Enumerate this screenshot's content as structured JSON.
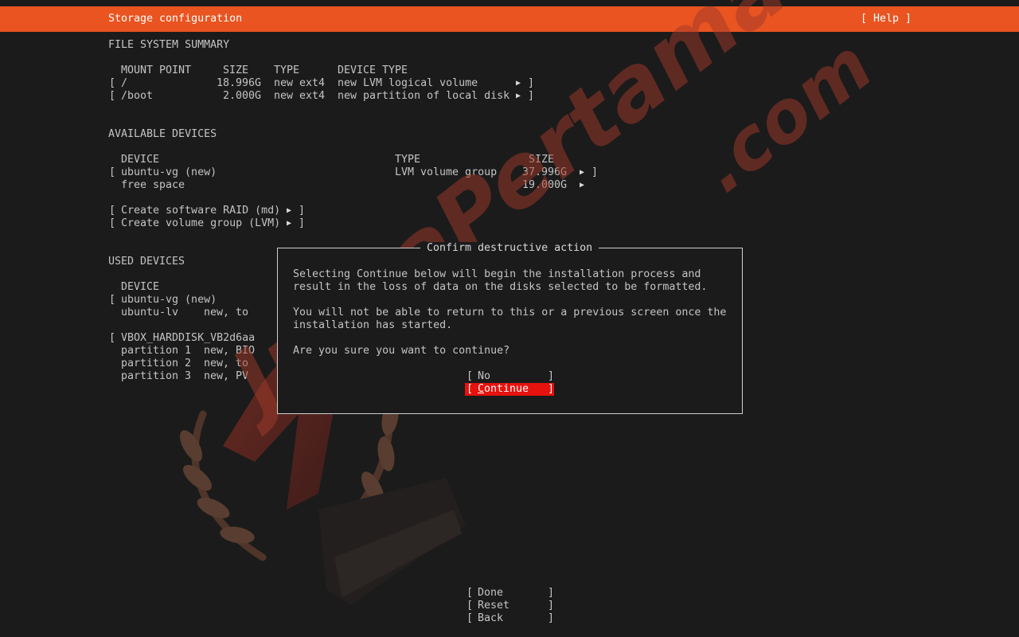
{
  "header": {
    "title": "Storage configuration",
    "help_label": "[ Help ]"
  },
  "fs_summary": {
    "heading": "FILE SYSTEM SUMMARY",
    "columns": {
      "mount_point": "MOUNT POINT",
      "size": "SIZE",
      "type": "TYPE",
      "device_type": "DEVICE TYPE"
    },
    "rows": [
      {
        "mount": "/",
        "size": "18.996G",
        "type": "new ext4",
        "device_type": "new LVM logical volume"
      },
      {
        "mount": "/boot",
        "size": "2.000G",
        "type": "new ext4",
        "device_type": "new partition of local disk"
      }
    ]
  },
  "available_devices": {
    "heading": "AVAILABLE DEVICES",
    "columns": {
      "device": "DEVICE",
      "type": "TYPE",
      "size": "SIZE"
    },
    "vg": {
      "name": "ubuntu-vg (new)",
      "type": "LVM volume group",
      "size": "37.996G"
    },
    "free": {
      "name": "free space",
      "size": "19.000G"
    },
    "actions": [
      "Create software RAID (md)",
      "Create volume group (LVM)"
    ]
  },
  "used_devices": {
    "heading": "USED DEVICES",
    "column_device": "DEVICE",
    "vg_name": "ubuntu-vg (new)",
    "lv_name": "ubuntu-lv",
    "lv_info": "new, to",
    "disk_name": "VBOX_HARDDISK_VB2d6aa",
    "partitions": [
      {
        "name": "partition 1",
        "info": "new, BIO"
      },
      {
        "name": "partition 2",
        "info": "new, to"
      },
      {
        "name": "partition 3",
        "info": "new, PV"
      }
    ]
  },
  "dialog": {
    "title": "Confirm destructive action",
    "line1": "Selecting Continue below will begin the installation process and",
    "line2": "result in the loss of data on the disks selected to be formatted.",
    "line3": "You will not be able to return to this or a previous screen once the",
    "line4": "installation has started.",
    "question": "Are you sure you want to continue?",
    "no_label": "No",
    "continue_first": "C",
    "continue_rest": "ontinue"
  },
  "footer": {
    "done": "Done",
    "reset": "Reset",
    "back": "Back"
  },
  "watermark": {
    "text": "JuaraPertama",
    "suffix": ".com"
  },
  "colors": {
    "header_bg": "#e95420",
    "background": "#1b1b1b",
    "focus_button": "#e6120e",
    "text": "#c4c4c4"
  }
}
